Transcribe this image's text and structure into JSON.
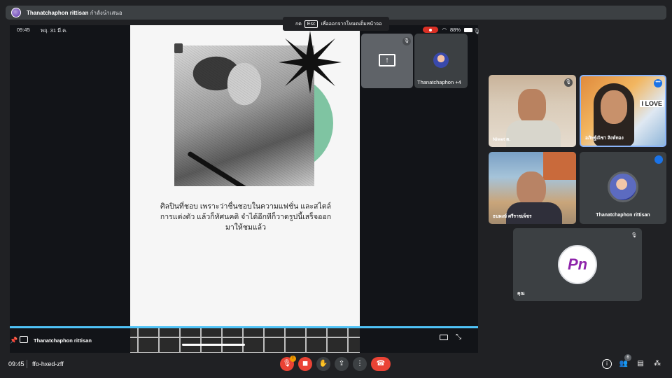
{
  "top_bar": {
    "presenter": "Thanatchaphon rittisan",
    "status": "กำลังนำเสนอ"
  },
  "esc_banner": {
    "prefix": "กด",
    "key": "Esc",
    "suffix": "เพื่อออกจากโหมดเต็มหน้าจอ"
  },
  "phone_status": {
    "time": "09:45",
    "date": "พฤ. 31 มี.ค.",
    "battery": "88%"
  },
  "slide": {
    "caption_lines": [
      "ศิลปินที่ชอบ   เพราะว่าชื่นชอบในความแฟชั่น และสไตล์",
      "การแต่งตัว แล้วก็ทัศนคติ จำได้อีกทีก็วาดรูปนี้เสร็จออก",
      "มาให้ชมแล้ว"
    ]
  },
  "stage_footer": {
    "presenter_name": "Thanatchaphon rittisan"
  },
  "share_tiles": {
    "group_label": "Thanatchaphon +4"
  },
  "participants": [
    {
      "name": "Niwet ต."
    },
    {
      "name": "อภิษฐ์ณิชา สิงห์ทอง"
    },
    {
      "name": "ธนพงษ์ ศรีราชเพ็ชร"
    },
    {
      "name": "Thanatchaphon rittisan"
    },
    {
      "name": "คุณ"
    }
  ],
  "woman_sign": "I LOVE",
  "you_avatar_text": "Pn",
  "bottom_bar": {
    "time": "09:45",
    "meeting_code": "ffo-hxed-zff",
    "people_count": "6"
  },
  "colors": {
    "background": "#202124",
    "tile": "#3c4043",
    "end_call": "#ea4335",
    "accent_blue": "#1a73e8",
    "progress": "#4fc3f7",
    "slide_green": "#7fc4a2"
  }
}
